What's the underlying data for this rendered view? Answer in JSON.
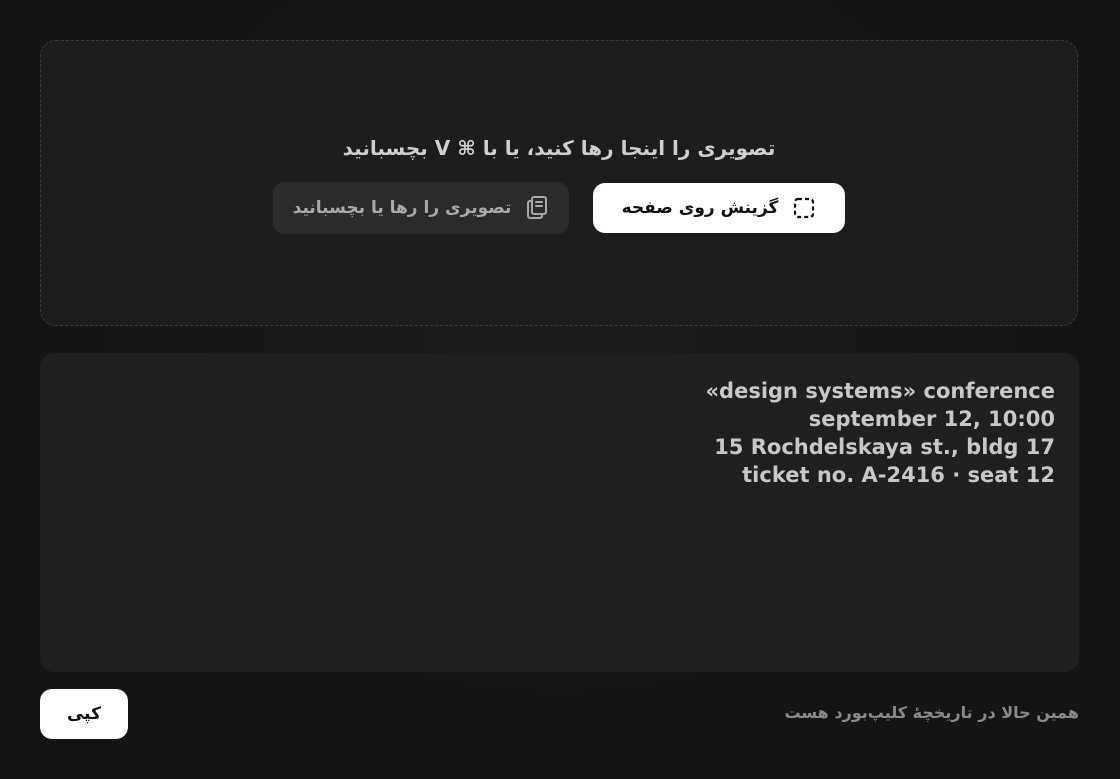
{
  "dropzone": {
    "hint": "تصویری را اینجا رها کنید، یا با ⌘ V بچسبانید",
    "paste_button_label": "تصویری را رها یا بچسبانید",
    "paste_icon": "clipboard-icon",
    "pick_button_label": "گزینش روی صفحه",
    "pick_icon": "selection-icon"
  },
  "result": {
    "lines": [
      "«design systems» conference",
      "september 12, 10:00",
      "15 Rochdelskaya st., bldg 17",
      "ticket no. A-2416 · seat 12"
    ]
  },
  "footer": {
    "copy_label": "کپی",
    "status": "همین حالا در تاریخچهٔ کلیپ‌بورد هست"
  }
}
